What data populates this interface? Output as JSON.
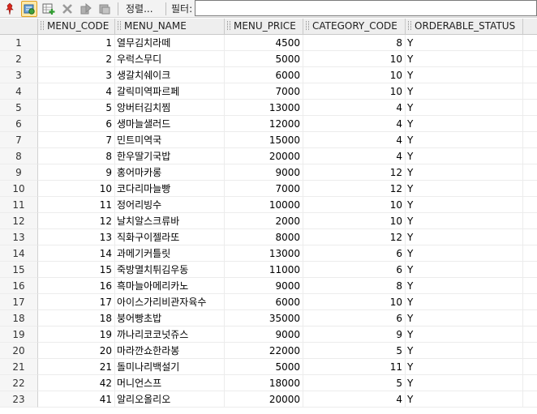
{
  "toolbar": {
    "sort_label": "정렬...",
    "filter_label": "필터:",
    "filter_value": "",
    "icons": [
      "pin-icon",
      "refresh-icon",
      "insert-row-icon",
      "delete-row-icon",
      "commit-icon",
      "rollback-icon"
    ]
  },
  "grid": {
    "columns": [
      "MENU_CODE",
      "MENU_NAME",
      "MENU_PRICE",
      "CATEGORY_CODE",
      "ORDERABLE_STATUS"
    ],
    "rows": [
      {
        "n": "1",
        "code": "1",
        "name": "열무김치라떼",
        "price": "4500",
        "cat": "8",
        "status": "Y"
      },
      {
        "n": "2",
        "code": "2",
        "name": "우럭스무디",
        "price": "5000",
        "cat": "10",
        "status": "Y"
      },
      {
        "n": "3",
        "code": "3",
        "name": "생갈치쉐이크",
        "price": "6000",
        "cat": "10",
        "status": "Y"
      },
      {
        "n": "4",
        "code": "4",
        "name": "갈릭미역파르페",
        "price": "7000",
        "cat": "10",
        "status": "Y"
      },
      {
        "n": "5",
        "code": "5",
        "name": "앙버터김치찜",
        "price": "13000",
        "cat": "4",
        "status": "Y"
      },
      {
        "n": "6",
        "code": "6",
        "name": "생마늘샐러드",
        "price": "12000",
        "cat": "4",
        "status": "Y"
      },
      {
        "n": "7",
        "code": "7",
        "name": "민트미역국",
        "price": "15000",
        "cat": "4",
        "status": "Y"
      },
      {
        "n": "8",
        "code": "8",
        "name": "한우딸기국밥",
        "price": "20000",
        "cat": "4",
        "status": "Y"
      },
      {
        "n": "9",
        "code": "9",
        "name": "홍어마카롱",
        "price": "9000",
        "cat": "12",
        "status": "Y"
      },
      {
        "n": "10",
        "code": "10",
        "name": "코다리마늘빵",
        "price": "7000",
        "cat": "12",
        "status": "Y"
      },
      {
        "n": "11",
        "code": "11",
        "name": "정어리빙수",
        "price": "10000",
        "cat": "10",
        "status": "Y"
      },
      {
        "n": "12",
        "code": "12",
        "name": "날치알스크류바",
        "price": "2000",
        "cat": "10",
        "status": "Y"
      },
      {
        "n": "13",
        "code": "13",
        "name": "직화구이젤라또",
        "price": "8000",
        "cat": "12",
        "status": "Y"
      },
      {
        "n": "14",
        "code": "14",
        "name": "과메기커틀릿",
        "price": "13000",
        "cat": "6",
        "status": "Y"
      },
      {
        "n": "15",
        "code": "15",
        "name": "죽방멸치튀김우동",
        "price": "11000",
        "cat": "6",
        "status": "Y"
      },
      {
        "n": "16",
        "code": "16",
        "name": "흑마늘아메리카노",
        "price": "9000",
        "cat": "8",
        "status": "Y"
      },
      {
        "n": "17",
        "code": "17",
        "name": "아이스가리비관자육수",
        "price": "6000",
        "cat": "10",
        "status": "Y"
      },
      {
        "n": "18",
        "code": "18",
        "name": "붕어빵초밥",
        "price": "35000",
        "cat": "6",
        "status": "Y"
      },
      {
        "n": "19",
        "code": "19",
        "name": "까나리코코넛쥬스",
        "price": "9000",
        "cat": "9",
        "status": "Y"
      },
      {
        "n": "20",
        "code": "20",
        "name": "마라깐쇼한라봉",
        "price": "22000",
        "cat": "5",
        "status": "Y"
      },
      {
        "n": "21",
        "code": "21",
        "name": "돌미나리백설기",
        "price": "5000",
        "cat": "11",
        "status": "Y"
      },
      {
        "n": "22",
        "code": "42",
        "name": "머니언스프",
        "price": "18000",
        "cat": "5",
        "status": "Y"
      },
      {
        "n": "23",
        "code": "41",
        "name": "알리오올리오",
        "price": "20000",
        "cat": "4",
        "status": "Y"
      }
    ]
  }
}
